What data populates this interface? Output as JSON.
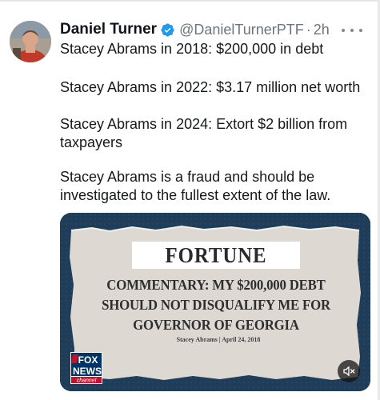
{
  "author": {
    "name": "Daniel Turner",
    "handle": "@DanielTurnerPTF",
    "separator": "·",
    "timestamp": "2h",
    "verified_color": "#1d9bf0",
    "avatar_icon": "person-avatar"
  },
  "tweet": {
    "lines": [
      "Stacey Abrams in 2018: $200,000 in debt",
      "Stacey Abrams in 2022: $3.17 million net worth",
      "Stacey Abrams in 2024: Extort $2 billion from taxpayers",
      "Stacey Abrams is a fraud and should be investigated to the fullest extent of the law."
    ]
  },
  "media": {
    "masthead": "FORTUNE",
    "headline": "COMMENTARY: MY $200,000 DEBT SHOULD NOT DISQUALIFY ME FOR GOVERNOR OF GEORGIA",
    "byline": "Stacey Abrams | April 24, 2018",
    "network_logo": {
      "line1": "FOX",
      "line2": "NEWS",
      "line3": "channel"
    },
    "mute_icon": "speaker-muted-icon",
    "background_color": "#1f3d58"
  },
  "colors": {
    "text": "#0f1419",
    "secondary": "#6b7580",
    "fox_red": "#c8102e",
    "fox_blue": "#003366"
  }
}
